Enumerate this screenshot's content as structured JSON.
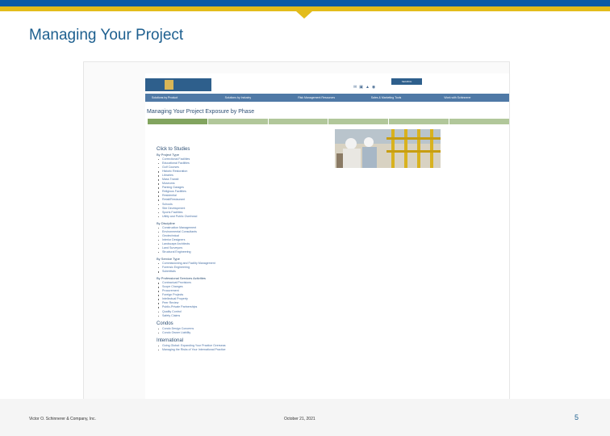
{
  "slide": {
    "title": "Managing Your Project",
    "footer_left": "Victor O. Schinnerer & Company, Inc.",
    "footer_date": "October 21, 2021",
    "page_number": "5"
  },
  "colors": {
    "brand_blue": "#0b5aa6",
    "brand_gold": "#e3bc1b",
    "title_blue": "#1d5f8f",
    "nav_blue": "#4f79a6",
    "tab_green": "#82a45f"
  },
  "site": {
    "search_label": "SEARCH",
    "header_icons": [
      "mail-icon",
      "print-icon",
      "share-icon",
      "rss-icon"
    ],
    "nav": [
      "Solutions by Product",
      "Solutions by Industry",
      "Risk Management Resources",
      "Sales & Marketing Tools",
      "Work with Schinnerer"
    ],
    "page_heading": "Managing Your Project Exposure by Phase",
    "click_studies": "Click to Studies",
    "sections": [
      {
        "title": "By Project Type",
        "items": [
          "Correctional Facilities",
          "Educational Facilities",
          "Golf Courses",
          "Historic Restoration",
          "Libraries",
          "Mass Transit",
          "Museums",
          "Parking Garages",
          "Religious Facilities",
          "Residential",
          "Retail/Restaurant",
          "Schools",
          "Site Development",
          "Sports Facilities",
          "Utility and Public Overhead"
        ]
      },
      {
        "title": "By Discipline",
        "items": [
          "Construction Management",
          "Environmental Consultants",
          "Geotechnical",
          "Interior Designers",
          "Landscape Architects",
          "Land Surveyors",
          "Structural Engineering"
        ]
      },
      {
        "title": "By Service Type",
        "items": [
          "Commissioning and Facility Management",
          "Forensic Engineering",
          "Submittals"
        ]
      },
      {
        "title": "By Professional Services Activities",
        "items": [
          "Contractual Provisions",
          "Scope Changes",
          "Procurement",
          "Foreign Projects",
          "Intellectual Property",
          "Peer Review",
          "Public-Private Partnerships",
          "Quality Control",
          "Safety Claims"
        ]
      },
      {
        "title": "Condos",
        "big": true,
        "items": [
          "Condo Design Concerns",
          "Condo Owner Liability"
        ]
      },
      {
        "title": "International",
        "big": true,
        "items": [
          "Going Global: Expanding Your Practice Overseas",
          "Managing the Risks of Your International Practice"
        ]
      }
    ]
  }
}
